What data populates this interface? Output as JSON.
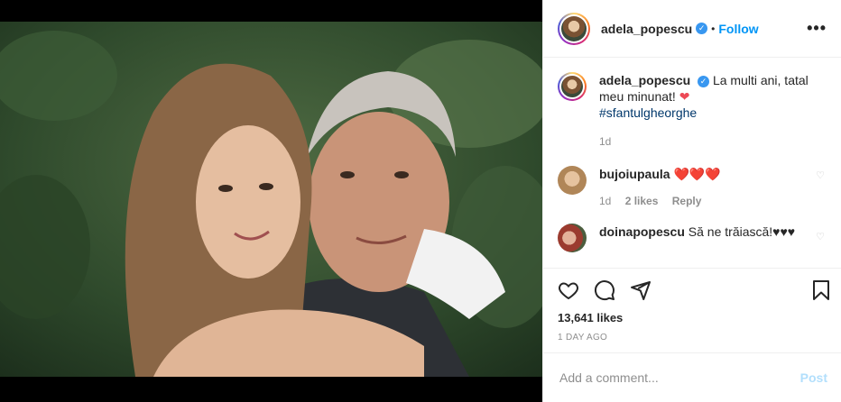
{
  "post": {
    "username": "adela_popescu",
    "follow_label": "Follow",
    "more_label": "•••",
    "caption": "La multi ani, tatal meu minunat!",
    "hashtag": "#sfantulgheorghe",
    "caption_age": "1d",
    "likes": "13,641 likes",
    "date": "1 DAY AGO"
  },
  "comments": [
    {
      "user": "bujoiupaula",
      "text": "❤️❤️❤️",
      "age": "1d",
      "likes": "2 likes",
      "reply": "Reply"
    },
    {
      "user": "doinapopescu",
      "text": "Să ne trăiască!♥♥♥"
    }
  ],
  "composer": {
    "placeholder": "Add a comment...",
    "post_label": "Post"
  },
  "icons": {
    "like": "heart-icon",
    "comment": "comment-icon",
    "share": "paper-plane-icon",
    "save": "bookmark-icon",
    "verified": "verified-badge-icon"
  },
  "colors": {
    "link": "#0095f6",
    "verified": "#3897f0",
    "muted": "#8e8e8e",
    "post_disabled": "#b2dffc"
  }
}
